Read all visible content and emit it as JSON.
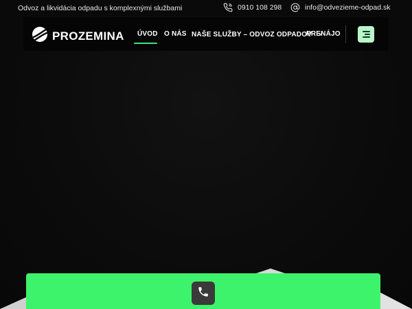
{
  "topbar": {
    "tagline": "Odvoz a likvidácia odpadu s komplexnými službami",
    "phone": "0910 108 298",
    "email": "info@odvezieme-odpad.sk",
    "phone_icon": "phone-icon",
    "email_icon": "at-sign-icon"
  },
  "logo": {
    "text": "PROZEMINA",
    "icon": "road-logo-icon"
  },
  "nav": {
    "items": [
      {
        "label": "ÚVOD"
      },
      {
        "label": "O NÁS"
      },
      {
        "label": "NAŠE SLUŽBY – ODVOZ ODPADOV"
      },
      {
        "label": "PRENÁJO"
      }
    ],
    "dropdown_icon": "chevron-down-icon",
    "menu_icon": "hamburger-menu-icon"
  },
  "cta": {
    "call_icon": "phone-icon"
  },
  "colors": {
    "accent": "#3ef36c",
    "menu_button": "#b9f5cc",
    "background": "#0b0b0b"
  }
}
